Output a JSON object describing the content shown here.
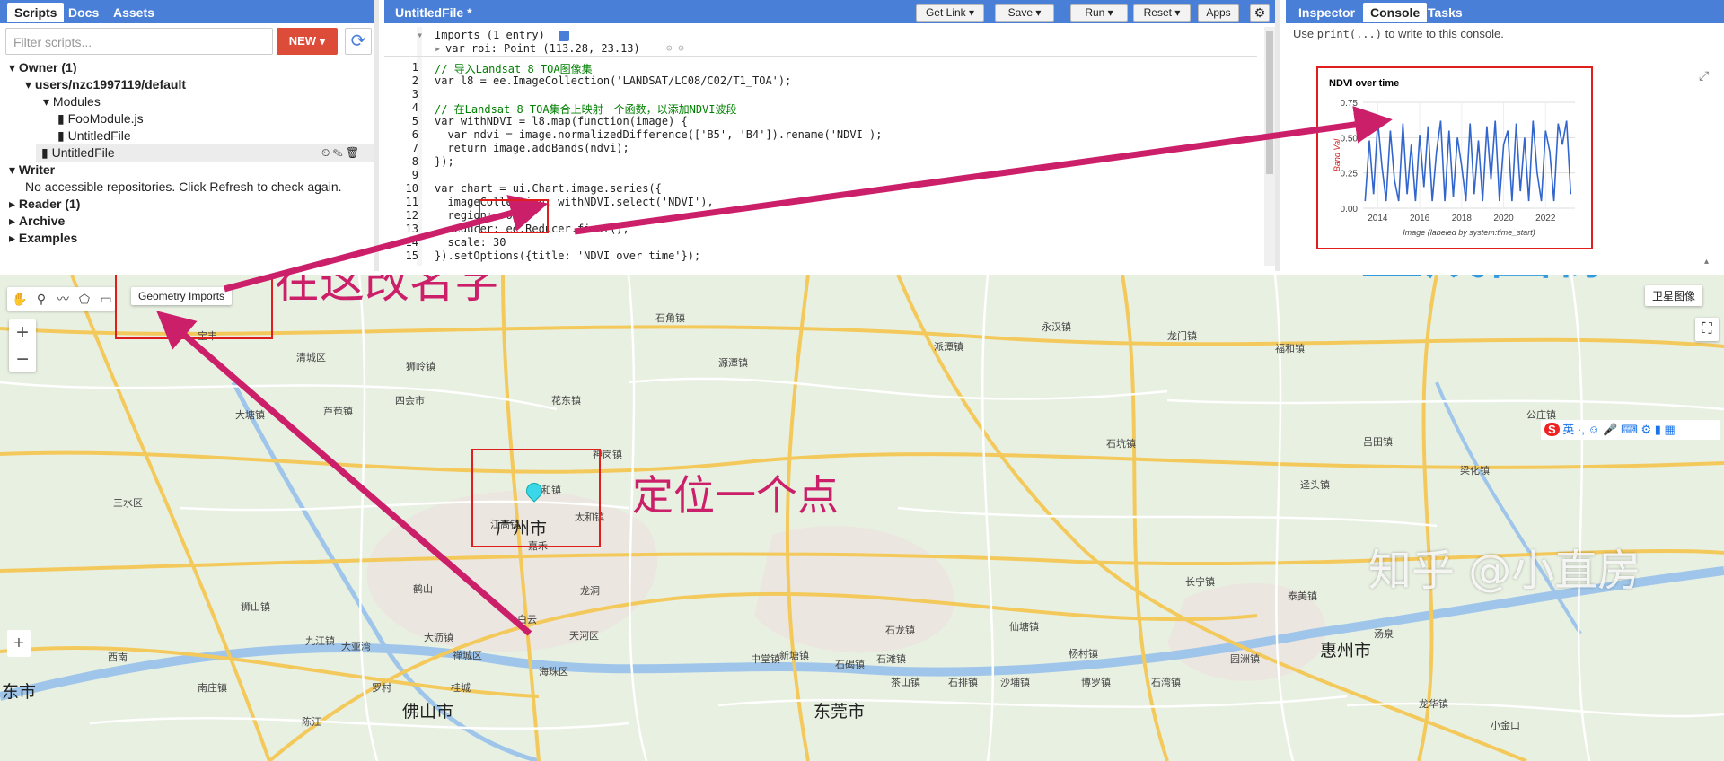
{
  "left_panel": {
    "tabs": [
      "Scripts",
      "Docs",
      "Assets"
    ],
    "filter_placeholder": "Filter scripts...",
    "new_label": "NEW",
    "tree": {
      "owner": "Owner (1)",
      "user_path": "users/nzc1997119/default",
      "modules": "Modules",
      "foo_module": "FooModule.js",
      "untitled_a": "UntitledFile",
      "untitled_b": "UntitledFile",
      "writer": "Writer",
      "writer_note": "No accessible repositories. Click Refresh to check again.",
      "reader": "Reader (1)",
      "archive": "Archive",
      "examples": "Examples"
    }
  },
  "editor": {
    "title": "UntitledFile *",
    "buttons": {
      "get_link": "Get Link",
      "save": "Save",
      "run": "Run",
      "reset": "Reset",
      "apps": "Apps"
    },
    "imports_line": "Imports (1 entry)",
    "roi_line": "var roi: Point (113.28, 23.13)",
    "lines": [
      "// 导入Landsat 8 TOA图像集",
      "var l8 = ee.ImageCollection('LANDSAT/LC08/C02/T1_TOA');",
      "",
      "// 在Landsat 8 TOA集合上映射一个函数，以添加NDVI波段",
      "var withNDVI = l8.map(function(image) {",
      "  var ndvi = image.normalizedDifference(['B5', 'B4']).rename('NDVI');",
      "  return image.addBands(ndvi);",
      "});",
      "",
      "var chart = ui.Chart.image.series({",
      "  imageCollection: withNDVI.select('NDVI'),",
      "  region: roi,",
      "  reducer: ee.Reducer.first(),",
      "  scale: 30",
      "}).setOptions({title: 'NDVI over time'});"
    ]
  },
  "right_panel": {
    "tabs": [
      "Inspector",
      "Console",
      "Tasks"
    ],
    "console_hint_pre": "Use ",
    "console_hint_code": "print(...)",
    "console_hint_post": " to write to this console."
  },
  "chart_data": {
    "type": "line",
    "title": "NDVI over time",
    "xlabel": "Image (labeled by system:time_start)",
    "ylabel": "Band Val",
    "xticks": [
      "2014",
      "2016",
      "2018",
      "2020",
      "2022"
    ],
    "yticks": [
      "0.00",
      "0.25",
      "0.50",
      "0.75"
    ],
    "ylim": [
      0,
      0.75
    ],
    "xlim": [
      2013.3,
      2023.4
    ],
    "series": [
      {
        "color": "#3366cc",
        "x": [
          2013.4,
          2013.6,
          2013.8,
          2014.0,
          2014.2,
          2014.4,
          2014.6,
          2014.8,
          2015.0,
          2015.2,
          2015.4,
          2015.6,
          2015.8,
          2016.0,
          2016.2,
          2016.4,
          2016.6,
          2016.8,
          2017.0,
          2017.2,
          2017.4,
          2017.6,
          2017.8,
          2018.0,
          2018.2,
          2018.4,
          2018.6,
          2018.8,
          2019.0,
          2019.2,
          2019.4,
          2019.6,
          2019.8,
          2020.0,
          2020.2,
          2020.4,
          2020.6,
          2020.8,
          2021.0,
          2021.2,
          2021.4,
          2021.6,
          2021.8,
          2022.0,
          2022.2,
          2022.4,
          2022.6,
          2022.8,
          2023.0,
          2023.2
        ],
        "y": [
          0.05,
          0.48,
          0.1,
          0.62,
          0.3,
          0.05,
          0.55,
          0.2,
          0.05,
          0.6,
          0.1,
          0.45,
          0.05,
          0.52,
          0.15,
          0.58,
          0.05,
          0.4,
          0.62,
          0.05,
          0.55,
          0.08,
          0.5,
          0.3,
          0.05,
          0.6,
          0.1,
          0.48,
          0.05,
          0.58,
          0.2,
          0.62,
          0.05,
          0.45,
          0.55,
          0.05,
          0.6,
          0.12,
          0.5,
          0.05,
          0.62,
          0.25,
          0.05,
          0.55,
          0.4,
          0.05,
          0.6,
          0.45,
          0.62,
          0.1
        ]
      }
    ]
  },
  "map": {
    "geometry_imports": "Geometry Imports",
    "satellite_label": "卫星图像",
    "cities": {
      "guangzhou": "广州市",
      "foshan": "佛山市",
      "dongguan": "东莞市",
      "huizhou": "惠州市",
      "left_edge": "东市"
    },
    "towns": [
      "清城区",
      "狮岭镇",
      "花东镇",
      "神岗镇",
      "人和镇",
      "江高镇",
      "太和镇",
      "嘉禾",
      "龙洞",
      "白云",
      "天河区",
      "海珠区",
      "大沥镇",
      "禅城区",
      "罗村",
      "桂城",
      "新塘镇",
      "石滩镇",
      "中堂镇",
      "石碣镇",
      "石龙镇",
      "茶山镇",
      "石排镇",
      "沙埔镇",
      "博罗镇",
      "杨村镇",
      "永汉镇",
      "龙门镇",
      "派潭镇",
      "石坑镇",
      "福和镇",
      "长宁镇",
      "泰美镇",
      "仙塘镇",
      "园洲镇",
      "石湾镇",
      "汤泉",
      "龙华镇",
      "小金口",
      "陈江",
      "大亚湾",
      "南庄镇",
      "九江镇",
      "狮山镇",
      "鹤山",
      "西南",
      "三水区",
      "大塘镇",
      "芦苞镇",
      "四会市",
      "宝丰",
      "石角镇",
      "源潭镇",
      "迳头镇",
      "吕田镇",
      "梁化镇",
      "公庄镇"
    ],
    "watermark": "知乎 @小直房",
    "annotations": {
      "rename": "在这改名字",
      "locate": "定位一个点",
      "generate": "生成图像"
    }
  }
}
